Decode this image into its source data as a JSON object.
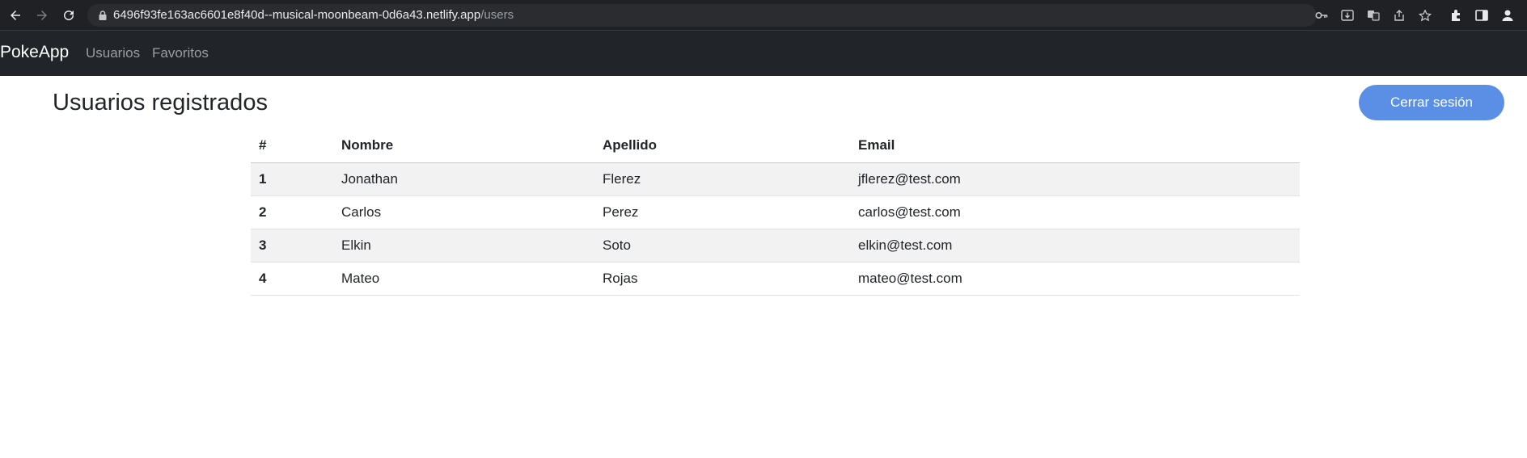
{
  "browser": {
    "url_host": "6496f93fe163ac6601e8f40d--musical-moonbeam-0d6a43.netlify.app",
    "url_path": "/users"
  },
  "navbar": {
    "brand": "PokeApp",
    "links": [
      "Usuarios",
      "Favoritos"
    ]
  },
  "page": {
    "title": "Usuarios registrados",
    "logout_label": "Cerrar sesión"
  },
  "table": {
    "headers": [
      "#",
      "Nombre",
      "Apellido",
      "Email"
    ],
    "rows": [
      [
        "1",
        "Jonathan",
        "Flerez",
        "jflerez@test.com"
      ],
      [
        "2",
        "Carlos",
        "Perez",
        "carlos@test.com"
      ],
      [
        "3",
        "Elkin",
        "Soto",
        "elkin@test.com"
      ],
      [
        "4",
        "Mateo",
        "Rojas",
        "mateo@test.com"
      ]
    ]
  }
}
